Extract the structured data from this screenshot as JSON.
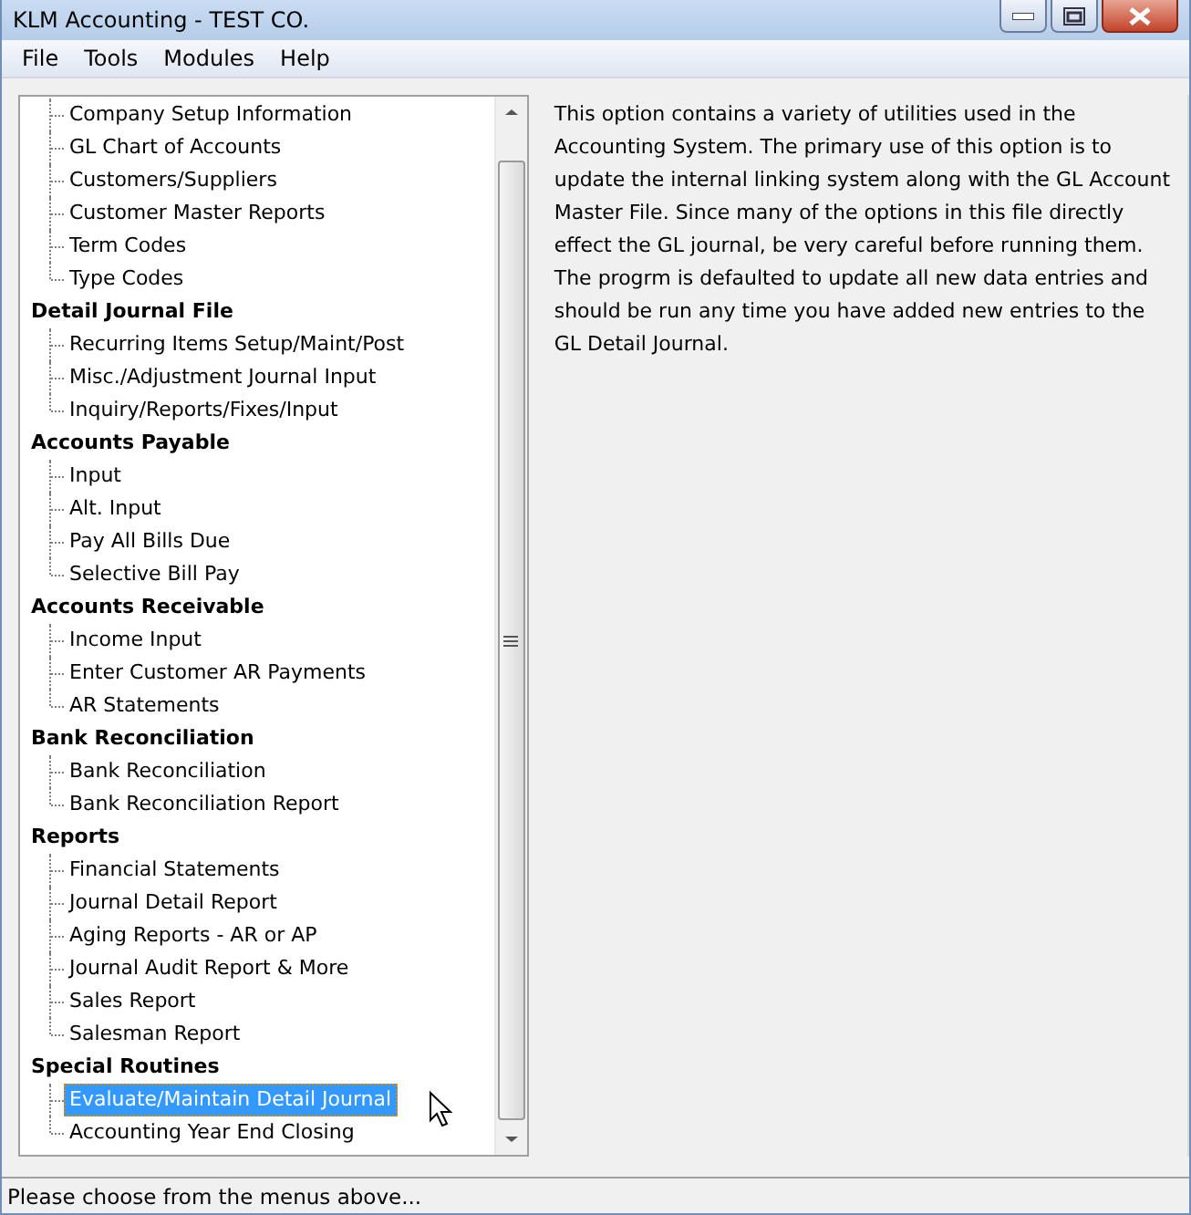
{
  "window": {
    "title": "KLM Accounting - TEST CO."
  },
  "menu": [
    "File",
    "Tools",
    "Modules",
    "Help"
  ],
  "tree": [
    {
      "children": [
        {
          "label": "Company Setup Information",
          "selected": false
        },
        {
          "label": "GL Chart of Accounts",
          "selected": false
        },
        {
          "label": "Customers/Suppliers",
          "selected": false
        },
        {
          "label": "Customer Master Reports",
          "selected": false
        },
        {
          "label": "Term Codes",
          "selected": false
        },
        {
          "label": "Type Codes",
          "selected": false
        }
      ]
    },
    {
      "label": "Detail Journal File",
      "children": [
        {
          "label": "Recurring Items Setup/Maint/Post",
          "selected": false
        },
        {
          "label": "Misc./Adjustment Journal Input",
          "selected": false
        },
        {
          "label": "Inquiry/Reports/Fixes/Input",
          "selected": false
        }
      ]
    },
    {
      "label": "Accounts Payable",
      "children": [
        {
          "label": "Input",
          "selected": false
        },
        {
          "label": "Alt. Input",
          "selected": false
        },
        {
          "label": "Pay All Bills Due",
          "selected": false
        },
        {
          "label": "Selective Bill Pay",
          "selected": false
        }
      ]
    },
    {
      "label": "Accounts Receivable",
      "children": [
        {
          "label": "Income Input",
          "selected": false
        },
        {
          "label": "Enter Customer AR Payments",
          "selected": false
        },
        {
          "label": "AR Statements",
          "selected": false
        }
      ]
    },
    {
      "label": "Bank Reconciliation",
      "children": [
        {
          "label": "Bank Reconciliation",
          "selected": false
        },
        {
          "label": "Bank Reconciliation Report",
          "selected": false
        }
      ]
    },
    {
      "label": "Reports",
      "children": [
        {
          "label": "Financial Statements",
          "selected": false
        },
        {
          "label": "Journal Detail Report",
          "selected": false
        },
        {
          "label": "Aging Reports - AR or AP",
          "selected": false
        },
        {
          "label": "Journal Audit Report & More",
          "selected": false
        },
        {
          "label": "Sales Report",
          "selected": false
        },
        {
          "label": "Salesman Report",
          "selected": false
        }
      ]
    },
    {
      "label": "Special Routines",
      "children": [
        {
          "label": "Evaluate/Maintain Detail Journal",
          "selected": true
        },
        {
          "label": "Accounting Year End Closing",
          "selected": false
        }
      ]
    }
  ],
  "description": "This option contains a variety of utilities used in the Accounting System. The primary use of this option is to update the internal linking system along with the GL Account Master File. Since many of the options in this file directly effect the GL journal, be very careful before running them. The progrm is defaulted to update all new data entries and should be run any time you have added new entries to the GL Detail Journal.",
  "status_bar": "Please choose from the menus above..."
}
